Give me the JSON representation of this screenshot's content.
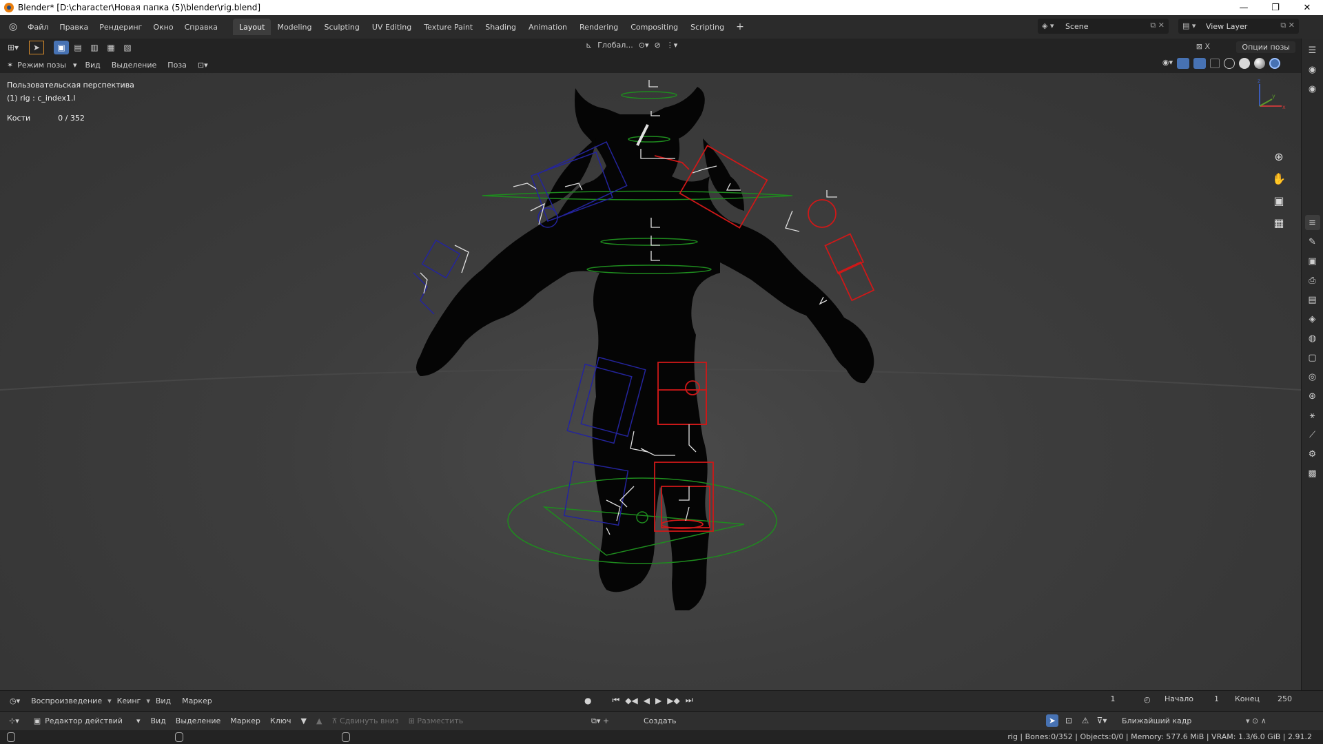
{
  "window": {
    "title": "Blender* [D:\\character\\Новая папка (5)\\blender\\rig.blend]",
    "controls": [
      "—",
      "❐",
      "✕"
    ]
  },
  "menu": [
    "Файл",
    "Правка",
    "Рендеринг",
    "Окно",
    "Справка"
  ],
  "workspaces": [
    {
      "label": "Layout",
      "active": true
    },
    {
      "label": "Modeling"
    },
    {
      "label": "Sculpting"
    },
    {
      "label": "UV Editing"
    },
    {
      "label": "Texture Paint"
    },
    {
      "label": "Shading"
    },
    {
      "label": "Animation"
    },
    {
      "label": "Rendering"
    },
    {
      "label": "Compositing"
    },
    {
      "label": "Scripting"
    }
  ],
  "scene": {
    "label": "Scene"
  },
  "view_layer": {
    "label": "View Layer"
  },
  "viewport_header": {
    "transform_orientation": "Глобал...",
    "options_label": "Опции позы",
    "mode_label": "Режим позы",
    "view": "Вид",
    "select": "Выделение",
    "pose": "Поза"
  },
  "viewport": {
    "perspective": "Пользовательская перспектива",
    "object_info": "(1) rig : c_index1.l",
    "bones_label": "Кости",
    "bones_value": "0 / 352",
    "gizmo_axes": {
      "x": "x",
      "y": "y",
      "z": "z"
    }
  },
  "timeline": {
    "playback": "Воспроизведение",
    "keying": "Кеинг",
    "view": "Вид",
    "marker": "Маркер",
    "current_frame": "1",
    "start_label": "Начало",
    "start_value": "1",
    "end_label": "Конец",
    "end_value": "250"
  },
  "action_editor": {
    "editor_type": "Редактор действий",
    "view": "Вид",
    "select": "Выделение",
    "marker": "Маркер",
    "key": "Ключ",
    "push_down": "Сдвинуть вниз",
    "stash": "Разместить",
    "create": "Создать",
    "snap": "Ближайший кадр"
  },
  "status": {
    "stats": "rig | Bones:0/352 | Objects:0/0 | Memory: 577.6 MiB | VRAM: 1.3/6.0 GiB | 2.91.2"
  },
  "colors": {
    "accent": "#4772b3",
    "bone_left": "#2a2aa8",
    "bone_right": "#d01818",
    "bone_center": "#1d8a1d"
  }
}
